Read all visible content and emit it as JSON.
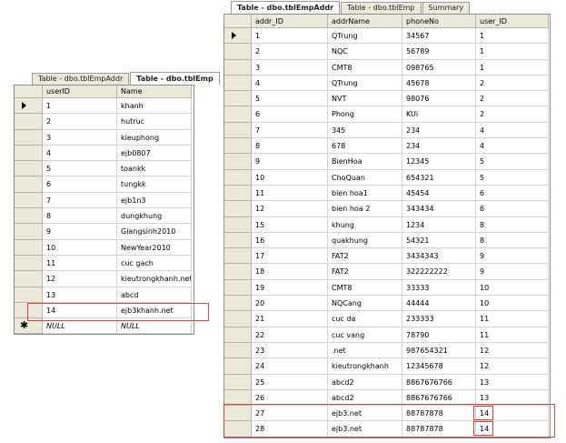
{
  "left": {
    "tabs": [
      "Table - dbo.tblEmpAddr",
      "Table - dbo.tblEmp"
    ],
    "active_tab": 1,
    "columns": [
      "userID",
      "Name"
    ],
    "rows": [
      [
        "1",
        "khanh"
      ],
      [
        "2",
        "hutruc"
      ],
      [
        "3",
        "kieuphong"
      ],
      [
        "4",
        "ejb0807"
      ],
      [
        "5",
        "toankk"
      ],
      [
        "6",
        "tungkk"
      ],
      [
        "7",
        "ejb1n3"
      ],
      [
        "8",
        "dungkhung"
      ],
      [
        "9",
        "Giangsinh2010"
      ],
      [
        "10",
        "NewYear2010"
      ],
      [
        "11",
        "cuc gach"
      ],
      [
        "12",
        "kieutrongkhanh.net"
      ],
      [
        "13",
        "abcd"
      ],
      [
        "14",
        "ejb3khanh.net"
      ]
    ],
    "new_row": [
      "NULL",
      "NULL"
    ]
  },
  "right": {
    "tabs": [
      "Table - dbo.tblEmpAddr",
      "Table - dbo.tblEmp",
      "Summary"
    ],
    "active_tab": 0,
    "columns": [
      "addr_ID",
      "addrName",
      "phoneNo",
      "user_ID"
    ],
    "rows": [
      [
        "1",
        "QTrung",
        "34567",
        "1"
      ],
      [
        "2",
        "NQC",
        "56789",
        "1"
      ],
      [
        "3",
        "CMT8",
        "098765",
        "1"
      ],
      [
        "4",
        "QTrung",
        "45678",
        "2"
      ],
      [
        "5",
        "NVT",
        "98076",
        "2"
      ],
      [
        "6",
        "Phong",
        "KUi",
        "2"
      ],
      [
        "7",
        "345",
        "234",
        "4"
      ],
      [
        "8",
        "678",
        "234",
        "4"
      ],
      [
        "9",
        "BienHoa",
        "12345",
        "5"
      ],
      [
        "10",
        "ChoQuan",
        "654321",
        "5"
      ],
      [
        "11",
        "bien hoa1",
        "45454",
        "6"
      ],
      [
        "12",
        "bien hoa 2",
        "343434",
        "6"
      ],
      [
        "15",
        "khung",
        "1234",
        "8"
      ],
      [
        "16",
        "quakhung",
        "54321",
        "8"
      ],
      [
        "17",
        "FAT2",
        "3434343",
        "9"
      ],
      [
        "18",
        "FAT2",
        "322222222",
        "9"
      ],
      [
        "19",
        "CMT8",
        "33333",
        "10"
      ],
      [
        "20",
        "NQCang",
        "44444",
        "10"
      ],
      [
        "21",
        "cuc da",
        "233333",
        "11"
      ],
      [
        "22",
        "cuc vang",
        "78790",
        "11"
      ],
      [
        "23",
        ".net",
        "987654321",
        "12"
      ],
      [
        "24",
        "kieutrongkhanh",
        "12345678",
        "12"
      ],
      [
        "25",
        "abcd2",
        "8867676766",
        "13"
      ],
      [
        "26",
        "abcd2",
        "8867676766",
        "13"
      ],
      [
        "27",
        "ejb3.net",
        "88787878",
        "14"
      ],
      [
        "28",
        "ejb3.net",
        "88787878",
        "14"
      ]
    ]
  },
  "colors": {
    "highlight": "#e0403a",
    "header_bg": "#ece9d8"
  }
}
